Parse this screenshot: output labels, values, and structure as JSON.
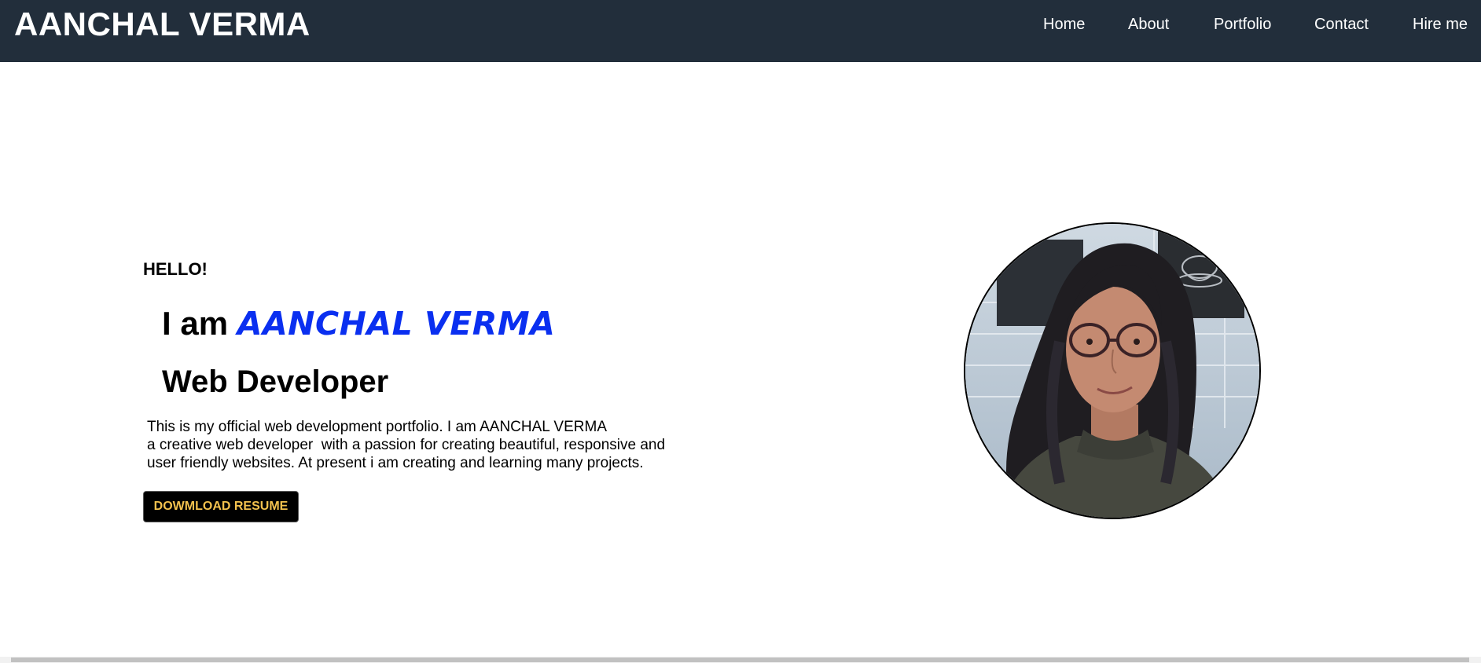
{
  "header": {
    "brand": "AANCHAL VERMA",
    "nav": [
      {
        "label": "Home"
      },
      {
        "label": "About"
      },
      {
        "label": "Portfolio"
      },
      {
        "label": "Contact"
      },
      {
        "label": "Hire me"
      }
    ]
  },
  "hero": {
    "greeting": "HELLO!",
    "intro_prefix": "I am ",
    "name": "AANCHAL VERMA",
    "role": "Web Developer",
    "bio_lines": [
      "This is my official web development portfolio. I am AANCHAL VERMA",
      "a creative web developer  with a passion for creating beautiful, responsive and",
      "user friendly websites. At present i am creating and learning many projects."
    ],
    "resume_button": "DOWMLOAD RESUME",
    "photo_alt": "profile photo"
  },
  "colors": {
    "navbar_bg": "#222e3b",
    "name_accent": "#0a2ff0",
    "button_text": "#f2c14e"
  },
  "icons": {
    "avatar": "profile-photo"
  }
}
